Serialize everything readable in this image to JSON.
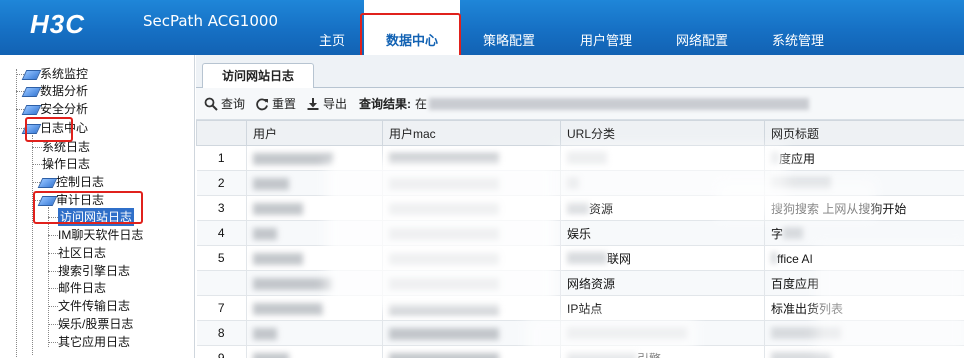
{
  "header": {
    "logo": "H3C",
    "product": "SecPath ACG1000",
    "nav": [
      {
        "label": "主页"
      },
      {
        "label": "数据中心"
      },
      {
        "label": "策略配置"
      },
      {
        "label": "用户管理"
      },
      {
        "label": "网络配置"
      },
      {
        "label": "系统管理"
      }
    ],
    "active_nav": "数据中心"
  },
  "sidebar": {
    "items": [
      {
        "label": "系统监控"
      },
      {
        "label": "数据分析"
      },
      {
        "label": "安全分析"
      },
      {
        "label": "日志中心"
      },
      {
        "label": "系统日志"
      },
      {
        "label": "操作日志"
      },
      {
        "label": "控制日志"
      },
      {
        "label": "审计日志"
      },
      {
        "label": "访问网站日志"
      },
      {
        "label": "IM聊天软件日志"
      },
      {
        "label": "社区日志"
      },
      {
        "label": "搜索引擎日志"
      },
      {
        "label": "邮件日志"
      },
      {
        "label": "文件传输日志"
      },
      {
        "label": "娱乐/股票日志"
      },
      {
        "label": "其它应用日志"
      }
    ],
    "selected": "访问网站日志"
  },
  "main": {
    "tab": "访问网站日志",
    "toolbar": {
      "query": "查询",
      "reset": "重置",
      "export": "导出",
      "result_label": "查询结果:",
      "result_text": "在"
    },
    "table": {
      "columns": [
        "",
        "用户",
        "用户mac",
        "URL分类",
        "网页标题"
      ],
      "rows": [
        {
          "num": "1",
          "url_cat": "",
          "title": "度应用"
        },
        {
          "num": "2",
          "url_cat": "",
          "title": ""
        },
        {
          "num": "3",
          "url_cat": "资源",
          "title": "搜狗搜索 上网从搜狗开始"
        },
        {
          "num": "4",
          "url_cat": "娱乐",
          "title": "字"
        },
        {
          "num": "5",
          "url_cat": "联网",
          "title": "ffice AI"
        },
        {
          "num": "",
          "url_cat": "网络资源",
          "title": "百度应用"
        },
        {
          "num": "7",
          "url_cat": "IP站点",
          "title": "标准出货列表"
        },
        {
          "num": "8",
          "url_cat": "",
          "title": ""
        },
        {
          "num": "9",
          "url_cat": "引擎",
          "title": ""
        }
      ]
    }
  },
  "colors": {
    "header_blue": "#1670c4",
    "highlight_red": "#e0211c",
    "selected_blue": "#2f6fc9"
  }
}
